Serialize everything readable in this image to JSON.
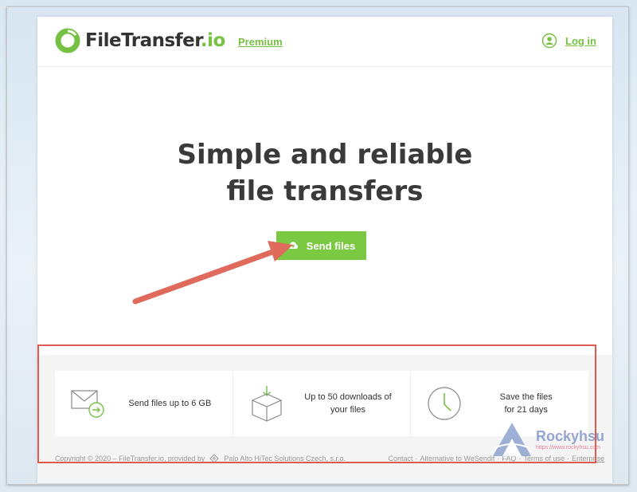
{
  "header": {
    "logo_name": "FileTransfer",
    "logo_tld": ".io",
    "premium_label": "Premium",
    "login_label": "Log in"
  },
  "hero": {
    "title_line1": "Simple and reliable",
    "title_line2": "file transfers",
    "send_button_label": "Send files"
  },
  "features": [
    {
      "icon": "envelope-arrow-icon",
      "text": "Send files up to 6 GB"
    },
    {
      "icon": "box-download-icon",
      "text_line1": "Up to 50 downloads of",
      "text_line2": "your files"
    },
    {
      "icon": "clock-icon",
      "text_line1": "Save the files",
      "text_line2": "for 21 days"
    }
  ],
  "footer": {
    "copyright": "Copyright © 2020 – FileTransfer.io, provided by",
    "company": "Palo Alto HiTec Solutions Czech, s.r.o.",
    "links": [
      "Contact",
      "Alternative to WeSendit",
      "FAQ",
      "Terms of use",
      "Enterprise"
    ],
    "separator": "·"
  },
  "watermark": {
    "name": "Rockyhsu",
    "url": "https://www.rockyhsu.com"
  },
  "colors": {
    "brand_green": "#7bc943",
    "annotation_red": "#dc5a4f",
    "text_dark": "#3a3a3a"
  }
}
